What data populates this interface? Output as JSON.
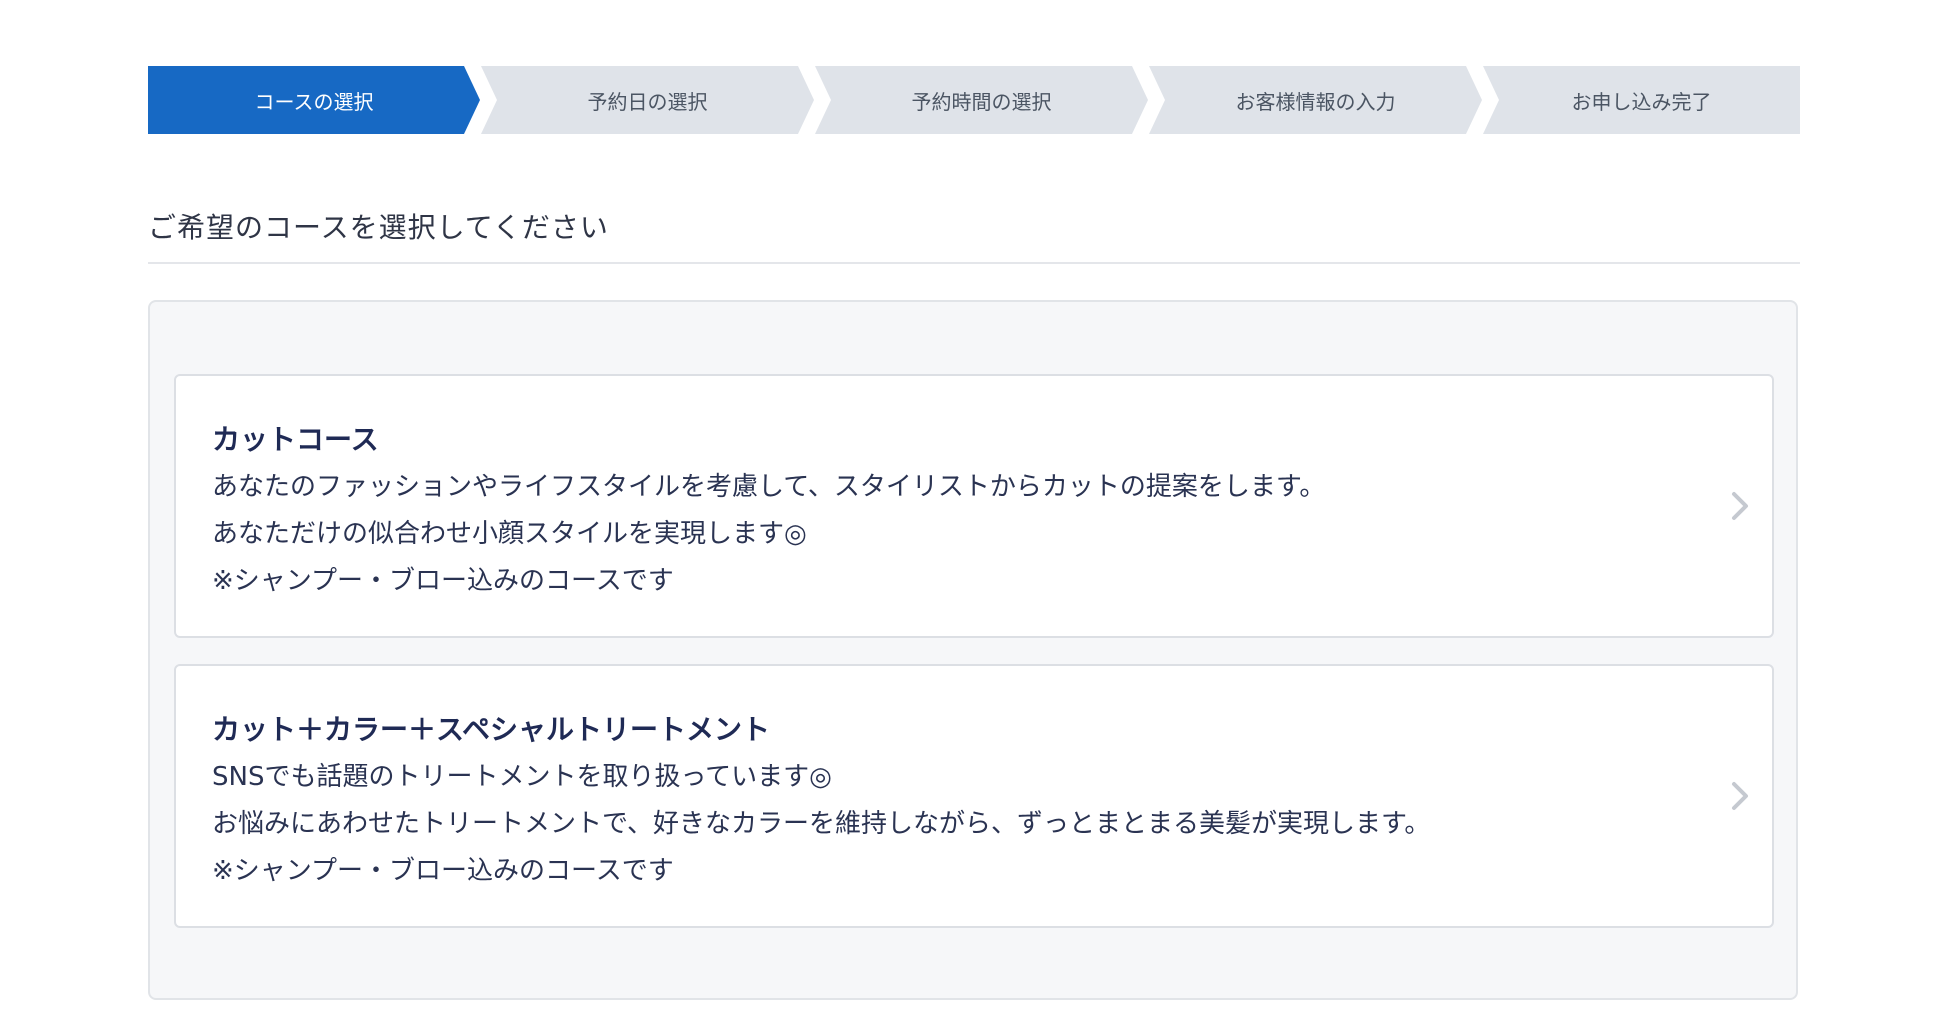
{
  "stepper": {
    "steps": [
      {
        "label": "コースの選択"
      },
      {
        "label": "予約日の選択"
      },
      {
        "label": "予約時間の選択"
      },
      {
        "label": "お客様情報の入力"
      },
      {
        "label": "お申し込み完了"
      }
    ],
    "active_step": 1
  },
  "section": {
    "title": "ご希望のコースを選択してください"
  },
  "courses": [
    {
      "title": "カットコース",
      "lines": [
        "あなたのファッションやライフスタイルを考慮して、スタイリストからカットの提案をします。",
        "あなただけの似合わせ小顔スタイルを実現します◎",
        "※シャンプー・ブロー込みのコースです"
      ]
    },
    {
      "title": "カット＋カラー＋スペシャルトリートメント",
      "lines": [
        "SNSでも話題のトリートメントを取り扱っています◎",
        "お悩みにあわせたトリートメントで、好きなカラーを維持しながら、ずっとまとまる美髪が実現します。",
        "※シャンプー・ブロー込みのコースです"
      ]
    }
  ],
  "colors": {
    "active_step": "#1769c4",
    "inactive_step": "#dfe3e9",
    "title_text": "#1f2a55",
    "panel_bg": "#f6f7f9"
  },
  "icons": {
    "card_chevron": "chevron-right-icon"
  }
}
